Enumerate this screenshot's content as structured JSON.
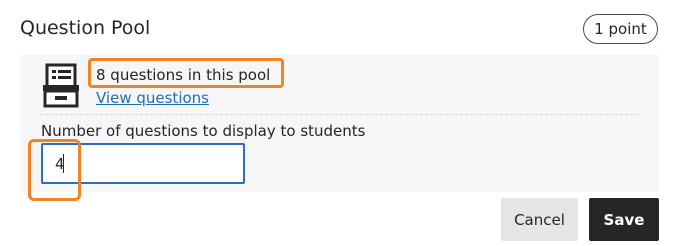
{
  "header": {
    "title": "Question Pool",
    "points_badge": "1 point"
  },
  "pool": {
    "icon": "question-pool-icon",
    "count_text": "8 questions in this pool",
    "view_link": "View questions"
  },
  "form": {
    "label": "Number of questions to display to students",
    "value": "4"
  },
  "actions": {
    "cancel_label": "Cancel",
    "save_label": "Save"
  },
  "colors": {
    "highlight": "#f0822a",
    "link": "#1f6fb2",
    "input_border": "#2a6fb7",
    "save_bg": "#262626"
  }
}
